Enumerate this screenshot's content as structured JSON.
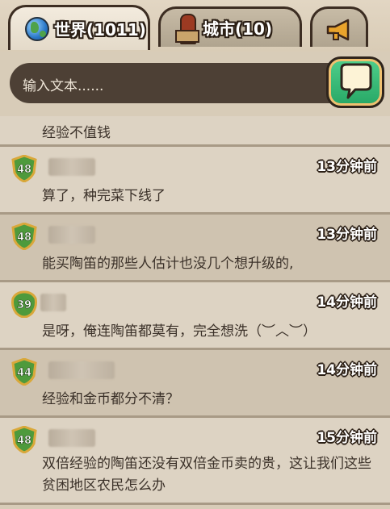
{
  "tabs": [
    {
      "label": "世界(1011)",
      "icon": "globe-icon"
    },
    {
      "label": "城市(10)",
      "icon": "city-icon"
    },
    {
      "icon": "horn-icon"
    }
  ],
  "input": {
    "placeholder": "输入文本......"
  },
  "previous_message": "经验不值钱",
  "messages": [
    {
      "level": "48",
      "time": "13分钟前",
      "text": "算了，种完菜下线了"
    },
    {
      "level": "48",
      "time": "13分钟前",
      "text": "能买陶笛的那些人估计也没几个想升级的,"
    },
    {
      "level": "39",
      "time": "14分钟前",
      "text": "是呀，俺连陶笛都莫有，完全想洗（︶︿︶）"
    },
    {
      "level": "44",
      "time": "14分钟前",
      "text": "经验和金币都分不清？"
    },
    {
      "level": "48",
      "time": "15分钟前",
      "text": "双倍经验的陶笛还没有双倍金币卖的贵，这让我们这些贫困地区农民怎么办"
    }
  ],
  "colors": {
    "send_button": "#27a766",
    "input_bg": "#4d4035",
    "badge_green": "#4e9a3c",
    "badge_gold": "#d9a83a"
  }
}
